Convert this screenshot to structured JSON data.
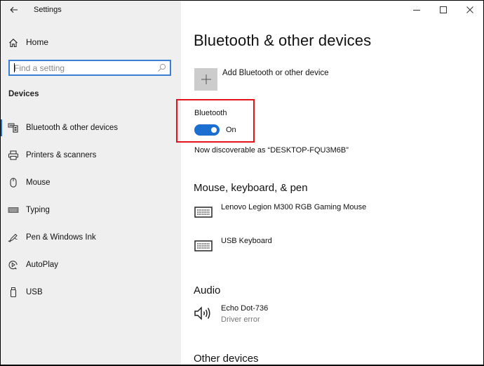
{
  "window": {
    "title": "Settings",
    "controls": {
      "minimize_icon": "minimize-icon",
      "maximize_icon": "maximize-icon",
      "close_icon": "close-icon"
    }
  },
  "sidebar": {
    "back_icon": "back-arrow-icon",
    "home": {
      "label": "Home",
      "icon": "home-icon"
    },
    "search": {
      "placeholder": "Find a setting",
      "value": "",
      "icon": "search-icon"
    },
    "section_heading": "Devices",
    "items": [
      {
        "label": "Bluetooth & other devices",
        "icon": "bluetooth-devices-icon",
        "selected": true
      },
      {
        "label": "Printers & scanners",
        "icon": "printer-icon",
        "selected": false
      },
      {
        "label": "Mouse",
        "icon": "mouse-icon",
        "selected": false
      },
      {
        "label": "Typing",
        "icon": "keyboard-icon",
        "selected": false
      },
      {
        "label": "Pen & Windows Ink",
        "icon": "pen-icon",
        "selected": false
      },
      {
        "label": "AutoPlay",
        "icon": "autoplay-icon",
        "selected": false
      },
      {
        "label": "USB",
        "icon": "usb-icon",
        "selected": false
      }
    ],
    "accent_color": "#1a6fd0"
  },
  "main": {
    "title": "Bluetooth & other devices",
    "add_device": {
      "label": "Add Bluetooth or other device",
      "icon": "plus-icon"
    },
    "bluetooth": {
      "label": "Bluetooth",
      "toggle_on": true,
      "state_label": "On",
      "discoverable_text": "Now discoverable as “DESKTOP-FQU3M6B”",
      "highlight_color": "#e0161c"
    },
    "sections": [
      {
        "title": "Mouse, keyboard, & pen",
        "devices": [
          {
            "name": "Lenovo Legion M300 RGB Gaming Mouse",
            "status": "",
            "icon": "keyboard-icon"
          },
          {
            "name": "USB Keyboard",
            "status": "",
            "icon": "keyboard-icon"
          }
        ]
      },
      {
        "title": "Audio",
        "devices": [
          {
            "name": "Echo Dot-736",
            "status": "Driver error",
            "icon": "speaker-icon"
          }
        ]
      },
      {
        "title": "Other devices",
        "devices": []
      }
    ]
  }
}
